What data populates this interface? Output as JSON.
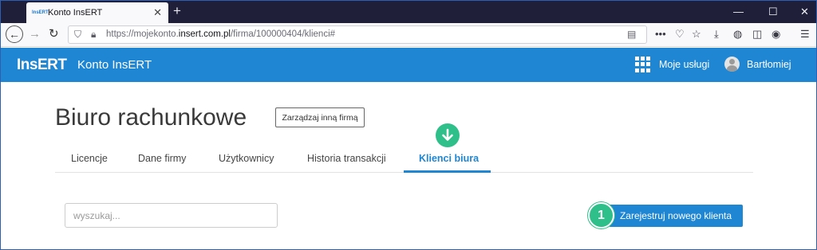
{
  "browser": {
    "tab_title": "Konto InsERT",
    "tab_favicon": "InsERT",
    "new_tab_icon": "+",
    "url_prefix": "https://mojekonto.",
    "url_domain": "insert.com.pl",
    "url_path": "/firma/100000404/klienci#"
  },
  "app": {
    "logo": "InsERT",
    "title": "Konto InsERT",
    "services_label": "Moje usługi",
    "user_name": "Bartłomiej"
  },
  "page": {
    "title": "Biuro rachunkowe",
    "manage_button": "Zarządzaj inną firmą",
    "tabs": [
      {
        "label": "Licencje"
      },
      {
        "label": "Dane firmy"
      },
      {
        "label": "Użytkownicy"
      },
      {
        "label": "Historia transakcji"
      },
      {
        "label": "Klienci biura",
        "active": true
      }
    ],
    "search_placeholder": "wyszukaj...",
    "register_button": "Zarejestruj nowego klienta",
    "step_number": "1"
  },
  "colors": {
    "accent": "#1f86d4",
    "badge": "#2fbf8a",
    "titlebar": "#1f1f3a"
  }
}
